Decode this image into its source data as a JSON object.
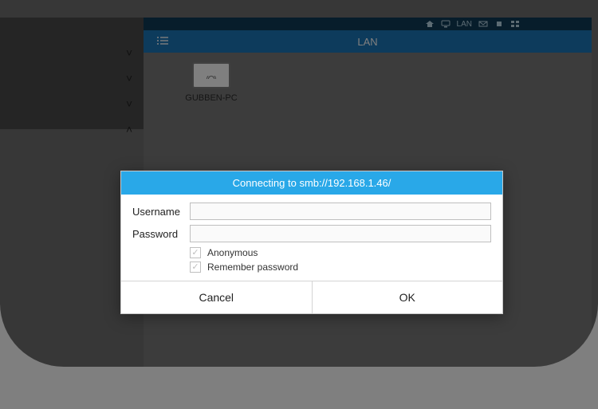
{
  "statusbar": {
    "lan_label": "LAN"
  },
  "header": {
    "title": "LAN"
  },
  "item": {
    "name": "GUBBEN-PC"
  },
  "dialog": {
    "title": "Connecting to smb://192.168.1.46/",
    "username_label": "Username",
    "password_label": "Password",
    "username_value": "",
    "password_value": "",
    "anonymous_label": "Anonymous",
    "remember_label": "Remember password",
    "anonymous_checked": true,
    "remember_checked": true,
    "cancel_label": "Cancel",
    "ok_label": "OK"
  }
}
